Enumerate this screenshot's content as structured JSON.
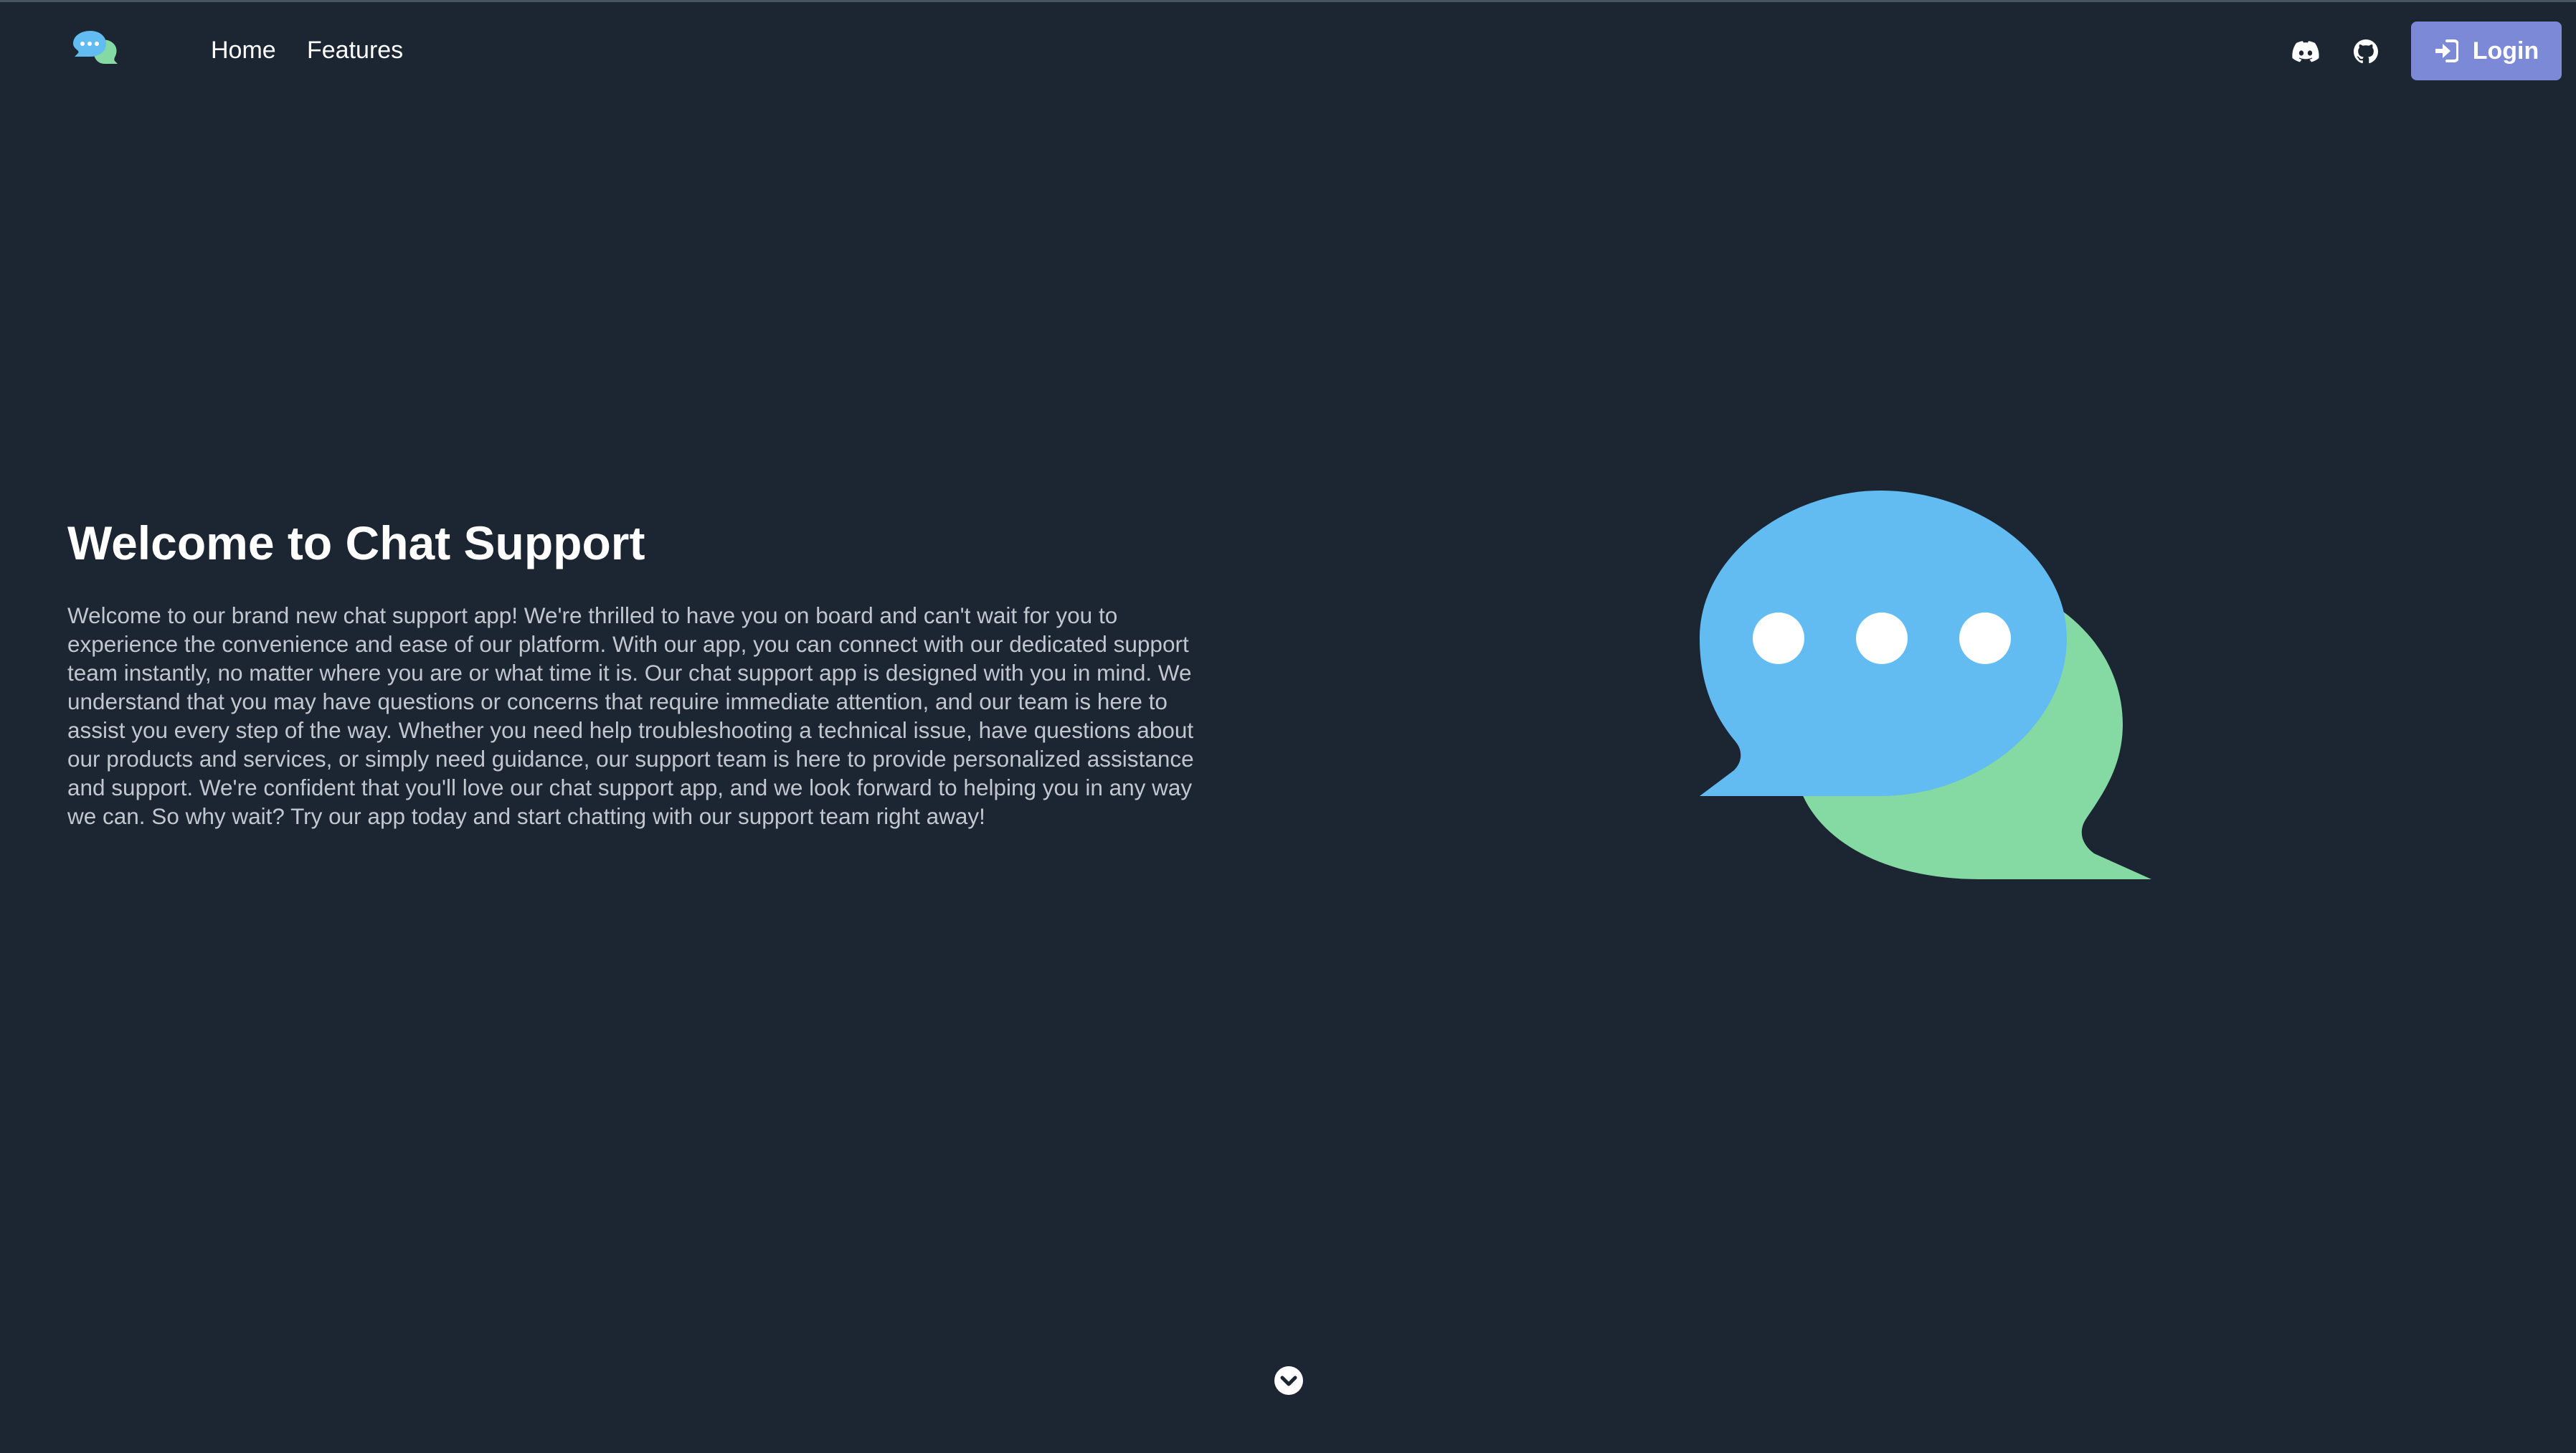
{
  "navbar": {
    "logo_icon": "chat-bubbles-logo-icon",
    "links": [
      {
        "label": "Home"
      },
      {
        "label": "Features"
      }
    ],
    "discord_icon": "discord-icon",
    "github_icon": "github-icon",
    "login": {
      "label": "Login",
      "icon": "login-arrow-icon",
      "color": "#7c89d6"
    }
  },
  "hero": {
    "title": "Welcome to Chat Support",
    "description": "Welcome to our brand new chat support app! We're thrilled to have you on board and can't wait for you to experience the convenience and ease of our platform. With our app, you can connect with our dedicated support team instantly, no matter where you are or what time it is. Our chat support app is designed with you in mind. We understand that you may have questions or concerns that require immediate attention, and our team is here to assist you every step of the way. Whether you need help troubleshooting a technical issue, have questions about our products and services, or simply need guidance, our support team is here to provide personalized assistance and support. We're confident that you'll love our chat support app, and we look forward to helping you in any way we can. So why wait? Try our app today and start chatting with our support team right away!",
    "illustration_icon": "chat-bubbles-illustration",
    "colors": {
      "blue_bubble": "#62bcf2",
      "green_bubble": "#85d9a2",
      "dots": "#ffffff"
    }
  },
  "scroll_icon": "chevron-down-circle-icon",
  "theme": {
    "background": "#1c2532",
    "text": "#ffffff",
    "muted_text": "#c2c7cf"
  }
}
